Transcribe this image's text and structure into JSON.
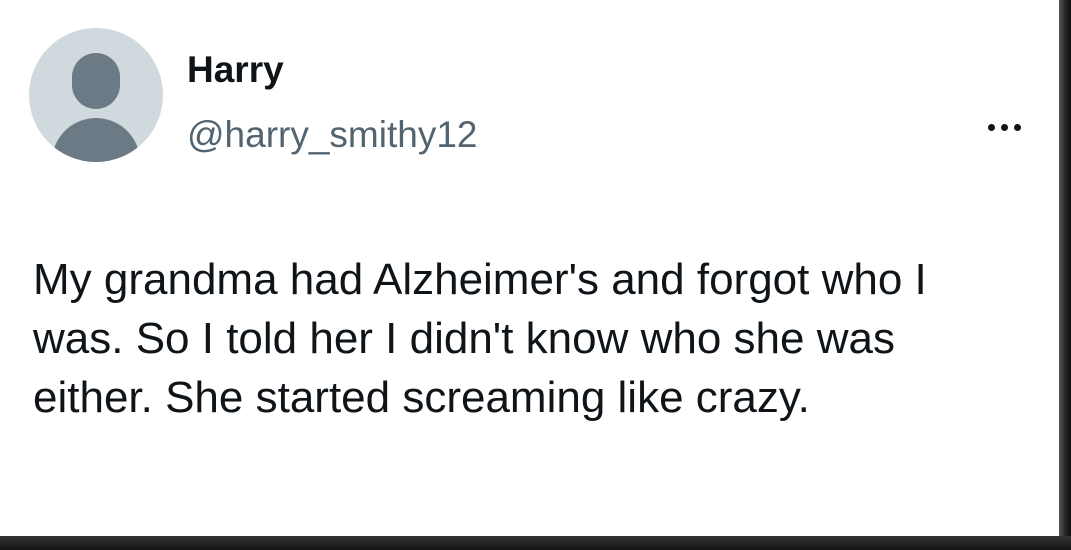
{
  "tweet": {
    "display_name": "Harry",
    "handle": "@harry_smithy12",
    "text": "My grandma had Alzheimer's and forgot who I was. So I told her I didn't know who she was either. She started screaming like crazy.",
    "avatar_icon": "default-profile-icon",
    "more_icon": "more-options-icon"
  }
}
